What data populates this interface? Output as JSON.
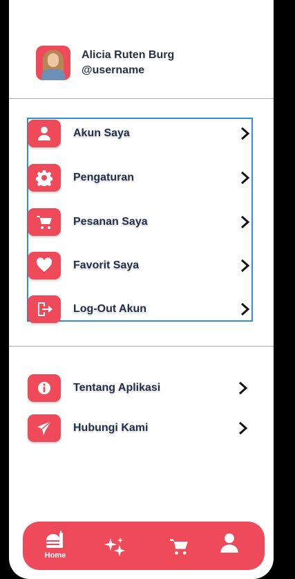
{
  "profile": {
    "name": "Alicia Ruten Burg",
    "username": "@username"
  },
  "menu": [
    {
      "label": "Akun Saya",
      "icon": "user-icon"
    },
    {
      "label": "Pengaturan",
      "icon": "gear-icon"
    },
    {
      "label": "Pesanan Saya",
      "icon": "cart-icon"
    },
    {
      "label": "Favorit Saya",
      "icon": "heart-icon"
    },
    {
      "label": "Log-Out Akun",
      "icon": "logout-icon"
    }
  ],
  "secondary": [
    {
      "label": "Tentang Aplikasi",
      "icon": "info-icon"
    },
    {
      "label": "Hubungi Kami",
      "icon": "send-icon"
    }
  ],
  "nav": {
    "home_label": "Home",
    "items": [
      "home-icon",
      "sparkle-icon",
      "cart-icon",
      "user-icon"
    ]
  },
  "colors": {
    "accent": "#ef4a5a",
    "text": "#22304a",
    "selection": "#2f8ee0"
  }
}
